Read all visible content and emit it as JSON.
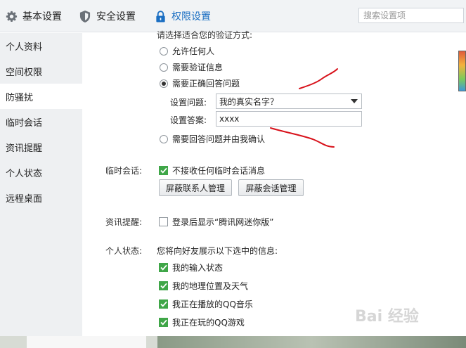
{
  "tabs": [
    {
      "label": "基本设置",
      "icon": "gear-icon"
    },
    {
      "label": "安全设置",
      "icon": "shield-icon"
    },
    {
      "label": "权限设置",
      "icon": "lock-icon"
    }
  ],
  "search": {
    "placeholder": "搜索设置项"
  },
  "sidebar": {
    "items": [
      {
        "label": "个人资料"
      },
      {
        "label": "空间权限"
      },
      {
        "label": "防骚扰"
      },
      {
        "label": "临时会话"
      },
      {
        "label": "资讯提醒"
      },
      {
        "label": "个人状态"
      },
      {
        "label": "远程桌面"
      }
    ],
    "active_index": 2
  },
  "verify": {
    "heading": "请选择适合您的验证方式:",
    "options": [
      {
        "label": "允许任何人",
        "checked": false
      },
      {
        "label": "需要验证信息",
        "checked": false
      },
      {
        "label": "需要正确回答问题",
        "checked": true
      },
      {
        "label": "需要回答问题并由我确认",
        "checked": false
      }
    ],
    "question_label": "设置问题:",
    "question_value": "我的真实名字？",
    "answer_label": "设置答案:",
    "answer_value": "xxxx"
  },
  "temp_session": {
    "section_label": "临时会话:",
    "option_label": "不接收任何临时会话消息",
    "checked": true,
    "buttons": [
      "屏蔽联系人管理",
      "屏蔽会话管理"
    ]
  },
  "news": {
    "section_label": "资讯提醒:",
    "option_label": "登录后显示“腾讯网迷你版”",
    "checked": false
  },
  "status": {
    "section_label": "个人状态:",
    "intro": "您将向好友展示以下选中的信息:",
    "options": [
      {
        "label": "我的输入状态",
        "checked": true
      },
      {
        "label": "我的地理位置及天气",
        "checked": true
      },
      {
        "label": "我正在播放的QQ音乐",
        "checked": true
      },
      {
        "label": "我正在玩的QQ游戏",
        "checked": true
      }
    ]
  },
  "watermark": "Bai 经验",
  "colors": {
    "accent": "#1a6ec2",
    "check": "#3fa648",
    "annotation": "#d8121b"
  }
}
